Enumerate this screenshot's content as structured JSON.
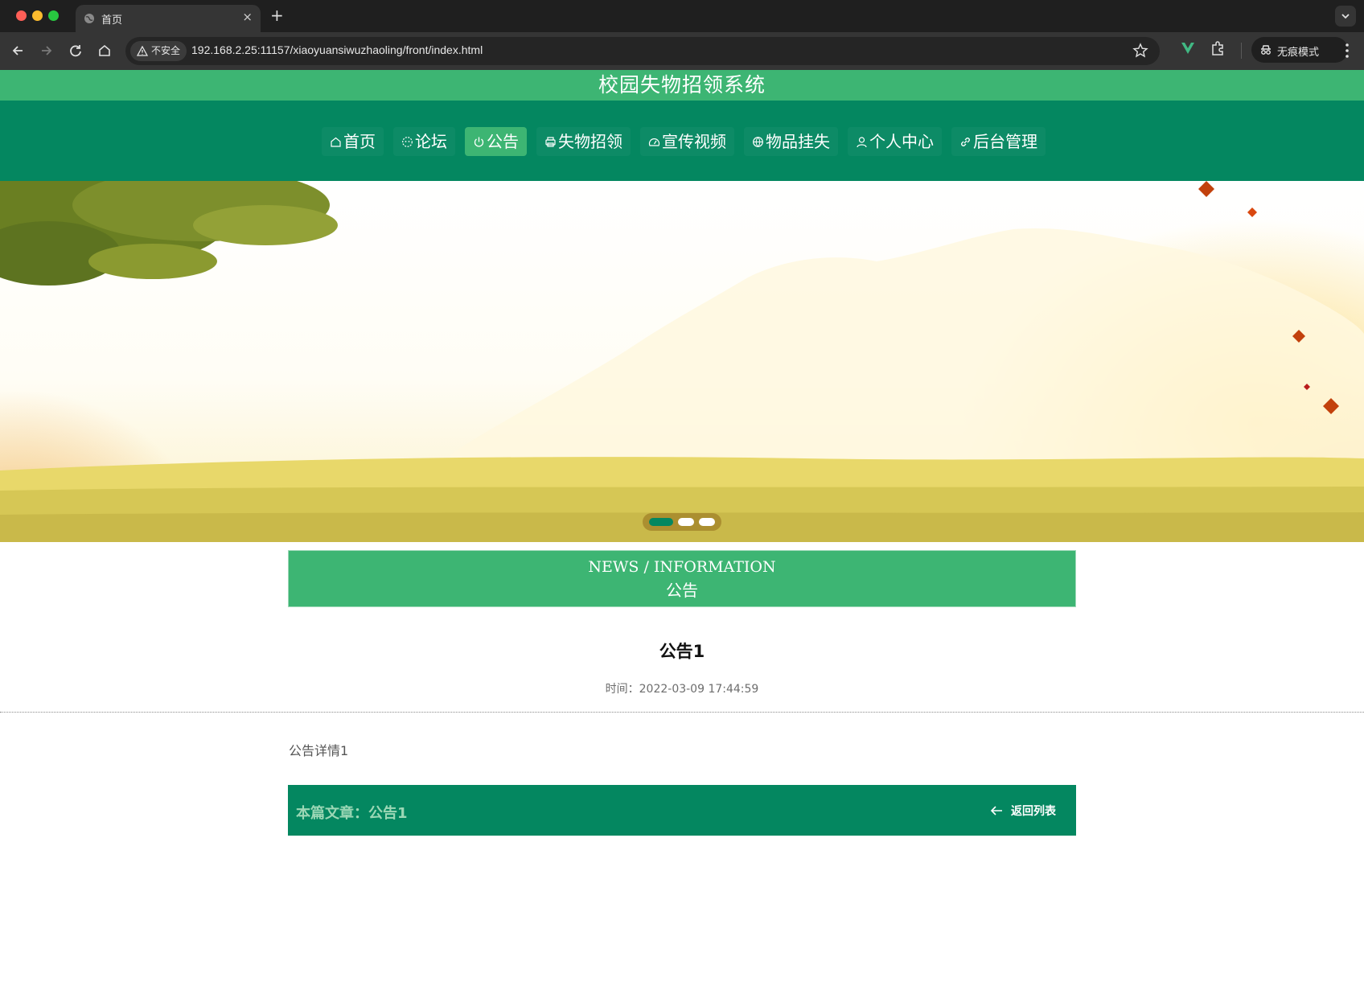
{
  "browser": {
    "tab_title": "首页",
    "security_label": "不安全",
    "url": "192.168.2.25:11157/xiaoyuansiwuzhaoling/front/index.html",
    "incognito_label": "无痕模式",
    "new_tab_symbol": "+",
    "close_tab_symbol": "×"
  },
  "site": {
    "title": "校园失物招领系统"
  },
  "nav": {
    "items": [
      {
        "label": "首页",
        "icon": "home-icon",
        "active": false
      },
      {
        "label": "论坛",
        "icon": "forum-icon",
        "active": false
      },
      {
        "label": "公告",
        "icon": "power-icon",
        "active": true
      },
      {
        "label": "失物招领",
        "icon": "printer-icon",
        "active": false
      },
      {
        "label": "宣传视频",
        "icon": "gauge-icon",
        "active": false
      },
      {
        "label": "物品挂失",
        "icon": "globe-icon",
        "active": false
      },
      {
        "label": "个人中心",
        "icon": "user-icon",
        "active": false
      },
      {
        "label": "后台管理",
        "icon": "link-icon",
        "active": false
      }
    ]
  },
  "carousel": {
    "slide_count": 3,
    "active_index": 0
  },
  "section": {
    "title_en": "NEWS / INFORMATION",
    "title_cn": "公告"
  },
  "article": {
    "title": "公告1",
    "time": "时间：2022-03-09 17:44:59",
    "body": "公告详情1",
    "footer_label": "本篇文章：公告1",
    "back_label": "返回列表"
  },
  "colors": {
    "title_bar": "#3db573",
    "nav_bg": "#048760",
    "active_nav": "#3db573",
    "footer_bg": "#048760"
  }
}
